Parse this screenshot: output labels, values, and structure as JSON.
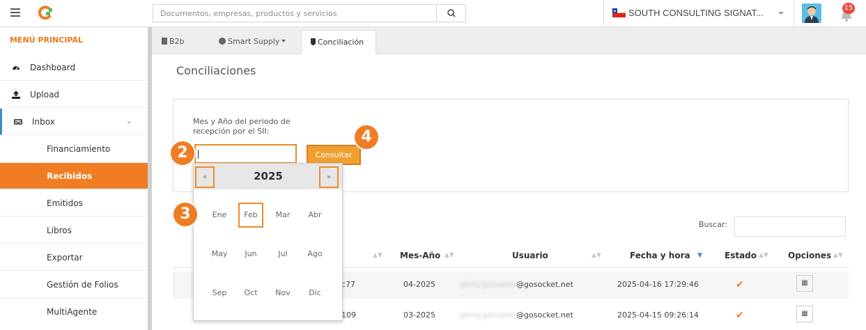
{
  "header": {
    "search_placeholder": "Documentos, empresas, productos y servicios",
    "company_name": "SOUTH CONSULTING SIGNAT...",
    "notification_count": "15"
  },
  "sidebar": {
    "title": "MENÚ PRINCIPAL",
    "items": [
      {
        "label": "Dashboard",
        "icon": "dashboard-icon"
      },
      {
        "label": "Upload",
        "icon": "upload-icon"
      },
      {
        "label": "Inbox",
        "icon": "inbox-icon"
      },
      {
        "label": "Financiamiento"
      },
      {
        "label": "Recibidos"
      },
      {
        "label": "Emitidos"
      },
      {
        "label": "Libros"
      },
      {
        "label": "Exportar"
      },
      {
        "label": "Gestión de Folios"
      },
      {
        "label": "MultiAgente"
      }
    ]
  },
  "tabs": [
    "B2b",
    "Smart Supply",
    "Conciliación"
  ],
  "page_title": "Conciliaciones",
  "form": {
    "label": "Mes y Año del periodo de recepción por el SII:",
    "input_value": "",
    "button": "Consultar"
  },
  "datepicker": {
    "prev": "«",
    "next": "»",
    "year": "2025",
    "months": [
      "Ene",
      "Feb",
      "Mar",
      "Abr",
      "May",
      "Jun",
      "Jul",
      "Ago",
      "Sep",
      "Oct",
      "Nov",
      "Dic"
    ],
    "highlighted_month": "Feb"
  },
  "markers": [
    "2",
    "3",
    "4"
  ],
  "table": {
    "search_label": "Buscar:",
    "headers": [
      "Mes-Año",
      "Usuario",
      "Fecha y hora",
      "Estado",
      "Opciones"
    ],
    "rows": [
      {
        "id_fragment": "c77",
        "mes_anio": "04-2025",
        "user_blurred": "gleny.gonzalez",
        "user_domain": "@gosocket.net",
        "fecha": "2025-04-16 17:29:46"
      },
      {
        "id_fragment": "109",
        "mes_anio": "03-2025",
        "user_blurred": "gleny.gonzalez",
        "user_domain": "@gosocket.net",
        "fecha": "2025-04-15 09:26:14"
      }
    ]
  },
  "colors": {
    "accent": "#f07c24",
    "active_nav": "#f07c24",
    "highlight_border": "#f08a24"
  }
}
